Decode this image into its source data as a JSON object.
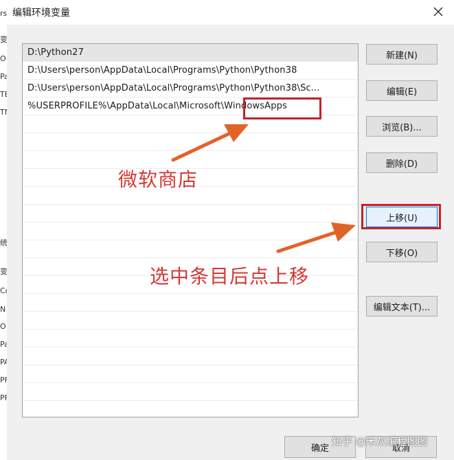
{
  "dialog": {
    "title": "编辑环境变量"
  },
  "path_entries": [
    "D:\\Python27",
    "D:\\Users\\person\\AppData\\Local\\Programs\\Python\\Python38",
    "D:\\Users\\person\\AppData\\Local\\Programs\\Python\\Python38\\Sc...",
    "%USERPROFILE%\\AppData\\Local\\Microsoft\\WindowsApps"
  ],
  "buttons": {
    "new": "新建(N)",
    "edit": "编辑(E)",
    "browse": "浏览(B)...",
    "delete": "删除(D)",
    "move_up": "上移(U)",
    "move_down": "下移(O)",
    "edit_text": "编辑文本(T)...",
    "ok": "确定",
    "cancel": "取消"
  },
  "annotations": {
    "store_label": "微软商店",
    "instruction": "选中条目后点上移"
  },
  "watermark": "知乎 @禾灰编程图图",
  "colors": {
    "annotation_red": "#d23a34",
    "highlight_border": "#c8202a",
    "button_blue_border": "#0078d7"
  },
  "behind_window_chars": [
    "rs",
    "变",
    "O",
    "Pa",
    "TE",
    "TN",
    "统",
    "变",
    "Co",
    "N",
    "O",
    "Pa",
    "PA",
    "PF",
    "PR"
  ]
}
